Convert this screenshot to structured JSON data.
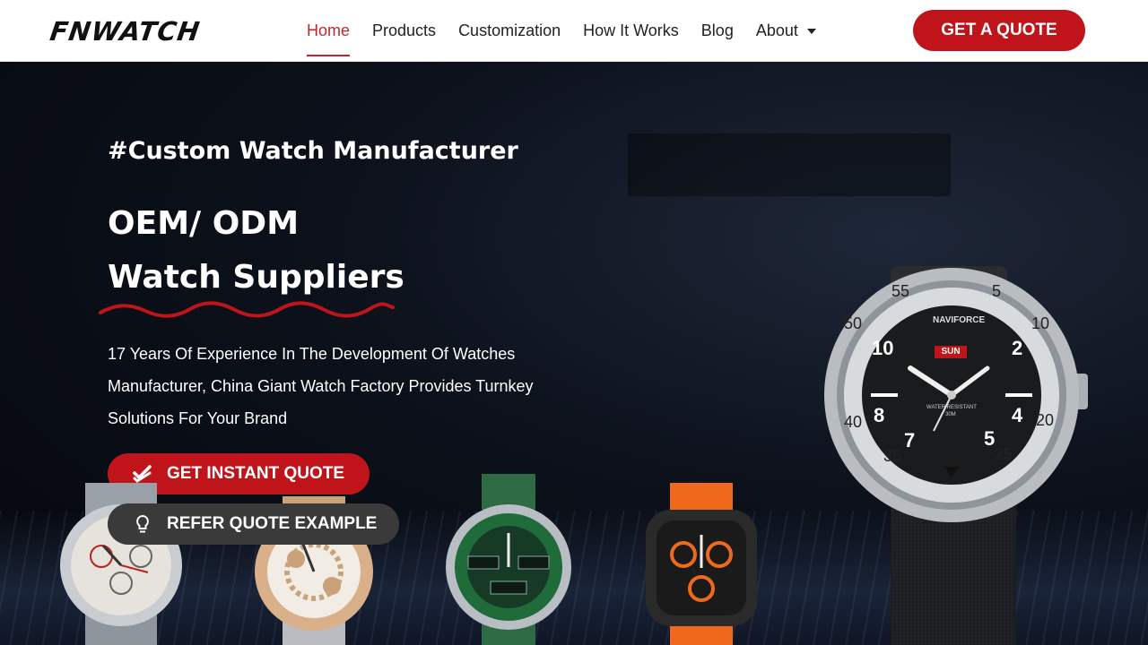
{
  "header": {
    "logo": "FNWATCH",
    "nav": [
      {
        "label": "Home",
        "active": true
      },
      {
        "label": "Products",
        "active": false
      },
      {
        "label": "Customization",
        "active": false
      },
      {
        "label": "How It Works",
        "active": false
      },
      {
        "label": "Blog",
        "active": false
      },
      {
        "label": "About",
        "active": false,
        "dropdown": true
      }
    ],
    "quote_button": "GET A QUOTE"
  },
  "hero": {
    "tagline": "#Custom Watch Manufacturer",
    "title_line1": "OEM/ ODM",
    "title_line2": "Watch Suppliers",
    "description": "17 Years Of Experience In The Development Of Watches Manufacturer, China Giant Watch Factory Provides Turnkey Solutions For Your Brand",
    "cta_primary": "GET INSTANT QUOTE",
    "cta_secondary": "REFER QUOTE EXAMPLE",
    "icons": {
      "primary": "double-check-icon",
      "secondary": "lightbulb-icon",
      "nav_about": "caret-down-icon"
    }
  },
  "watch_face": {
    "brand": "NAVIFORCE",
    "day": "SUN",
    "water_resistant": "WATER RESISTANT",
    "depth": "30M",
    "hours": [
      "10",
      "2",
      "4",
      "8",
      "5",
      "7"
    ],
    "bezel": [
      "50",
      "55",
      "5",
      "10",
      "20",
      "25",
      "35",
      "40"
    ]
  },
  "colors": {
    "accent": "#c0141b",
    "nav_active": "#c0272d",
    "dark_button": "#3a3a3a"
  }
}
